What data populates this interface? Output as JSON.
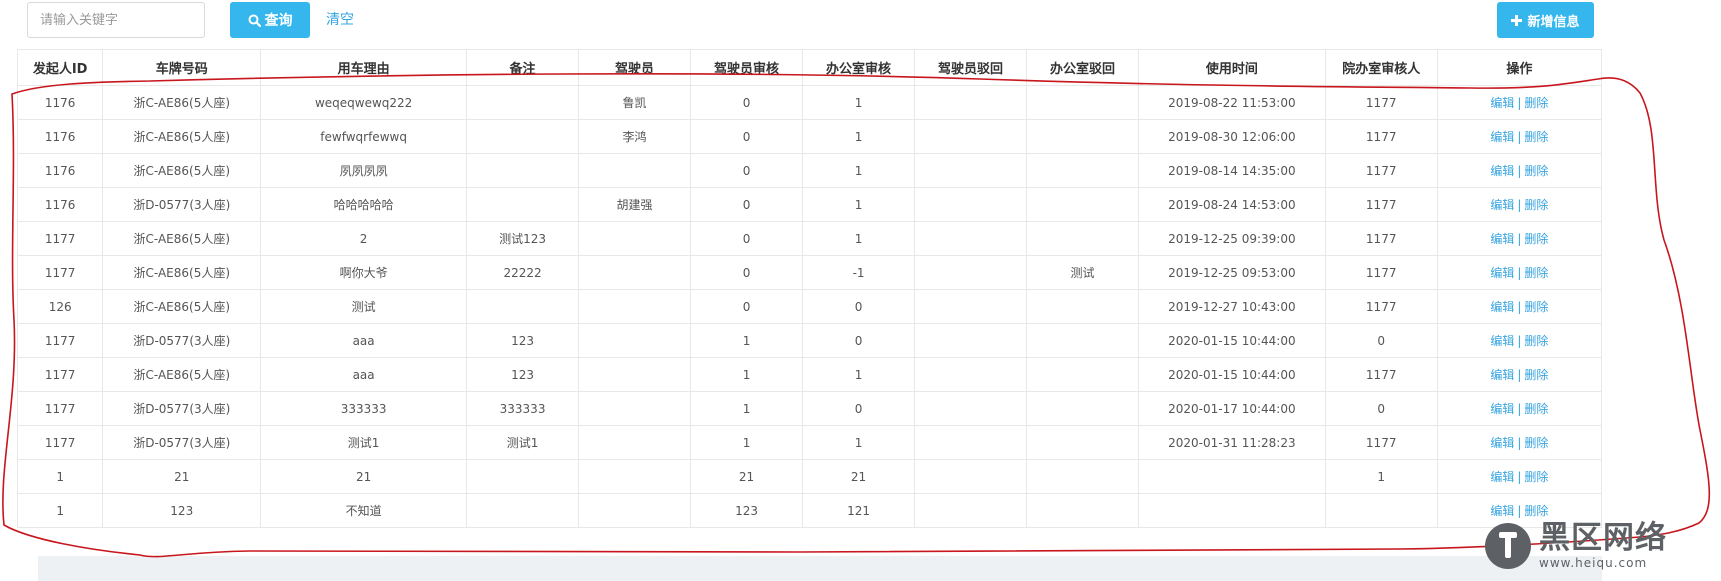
{
  "toolbar": {
    "search_placeholder": "请输入关键字",
    "query_label": "查询",
    "clear_label": "清空",
    "add_label": "新增信息"
  },
  "table": {
    "headers": [
      "发起人ID",
      "车牌号码",
      "用车理由",
      "备注",
      "驾驶员",
      "驾驶员审核",
      "办公室审核",
      "驾驶员驳回",
      "办公室驳回",
      "使用时间",
      "院办室审核人",
      "操作"
    ],
    "rows": [
      [
        "1176",
        "浙C-AE86(5人座)",
        "weqeqwewq222",
        "",
        "鲁凯",
        "0",
        "1",
        "",
        "",
        "2019-08-22 11:53:00",
        "1177"
      ],
      [
        "1176",
        "浙C-AE86(5人座)",
        "fewfwqrfewwq",
        "",
        "李鸿",
        "0",
        "1",
        "",
        "",
        "2019-08-30 12:06:00",
        "1177"
      ],
      [
        "1176",
        "浙C-AE86(5人座)",
        "夙夙夙夙",
        "",
        "",
        "0",
        "1",
        "",
        "",
        "2019-08-14 14:35:00",
        "1177"
      ],
      [
        "1176",
        "浙D-0577(3人座)",
        "哈哈哈哈哈",
        "",
        "胡建强",
        "0",
        "1",
        "",
        "",
        "2019-08-24 14:53:00",
        "1177"
      ],
      [
        "1177",
        "浙C-AE86(5人座)",
        "2",
        "测试123",
        "",
        "0",
        "1",
        "",
        "",
        "2019-12-25 09:39:00",
        "1177"
      ],
      [
        "1177",
        "浙C-AE86(5人座)",
        "啊你大爷",
        "22222",
        "",
        "0",
        "-1",
        "",
        "测试",
        "2019-12-25 09:53:00",
        "1177"
      ],
      [
        "126",
        "浙C-AE86(5人座)",
        "测试",
        "",
        "",
        "0",
        "0",
        "",
        "",
        "2019-12-27 10:43:00",
        "1177"
      ],
      [
        "1177",
        "浙D-0577(3人座)",
        "aaa",
        "123",
        "",
        "1",
        "0",
        "",
        "",
        "2020-01-15 10:44:00",
        "0"
      ],
      [
        "1177",
        "浙C-AE86(5人座)",
        "aaa",
        "123",
        "",
        "1",
        "1",
        "",
        "",
        "2020-01-15 10:44:00",
        "1177"
      ],
      [
        "1177",
        "浙D-0577(3人座)",
        "333333",
        "333333",
        "",
        "1",
        "0",
        "",
        "",
        "2020-01-17 10:44:00",
        "0"
      ],
      [
        "1177",
        "浙D-0577(3人座)",
        "测试1",
        "测试1",
        "",
        "1",
        "1",
        "",
        "",
        "2020-01-31 11:28:23",
        "1177"
      ],
      [
        "1",
        "21",
        "21",
        "",
        "",
        "21",
        "21",
        "",
        "",
        "",
        "1"
      ],
      [
        "1",
        "123",
        "不知道",
        "",
        "",
        "123",
        "121",
        "",
        "",
        "",
        ""
      ]
    ],
    "row_actions": {
      "edit_label": "编辑",
      "separator": "|",
      "delete_label": "删除"
    }
  },
  "watermark": {
    "name": "黑区网络",
    "url": "www.heiqu.com"
  },
  "colors": {
    "accent": "#35b7ee",
    "link": "#35a4e0",
    "annotation": "#c8161d",
    "watermark": "#5d6165"
  }
}
